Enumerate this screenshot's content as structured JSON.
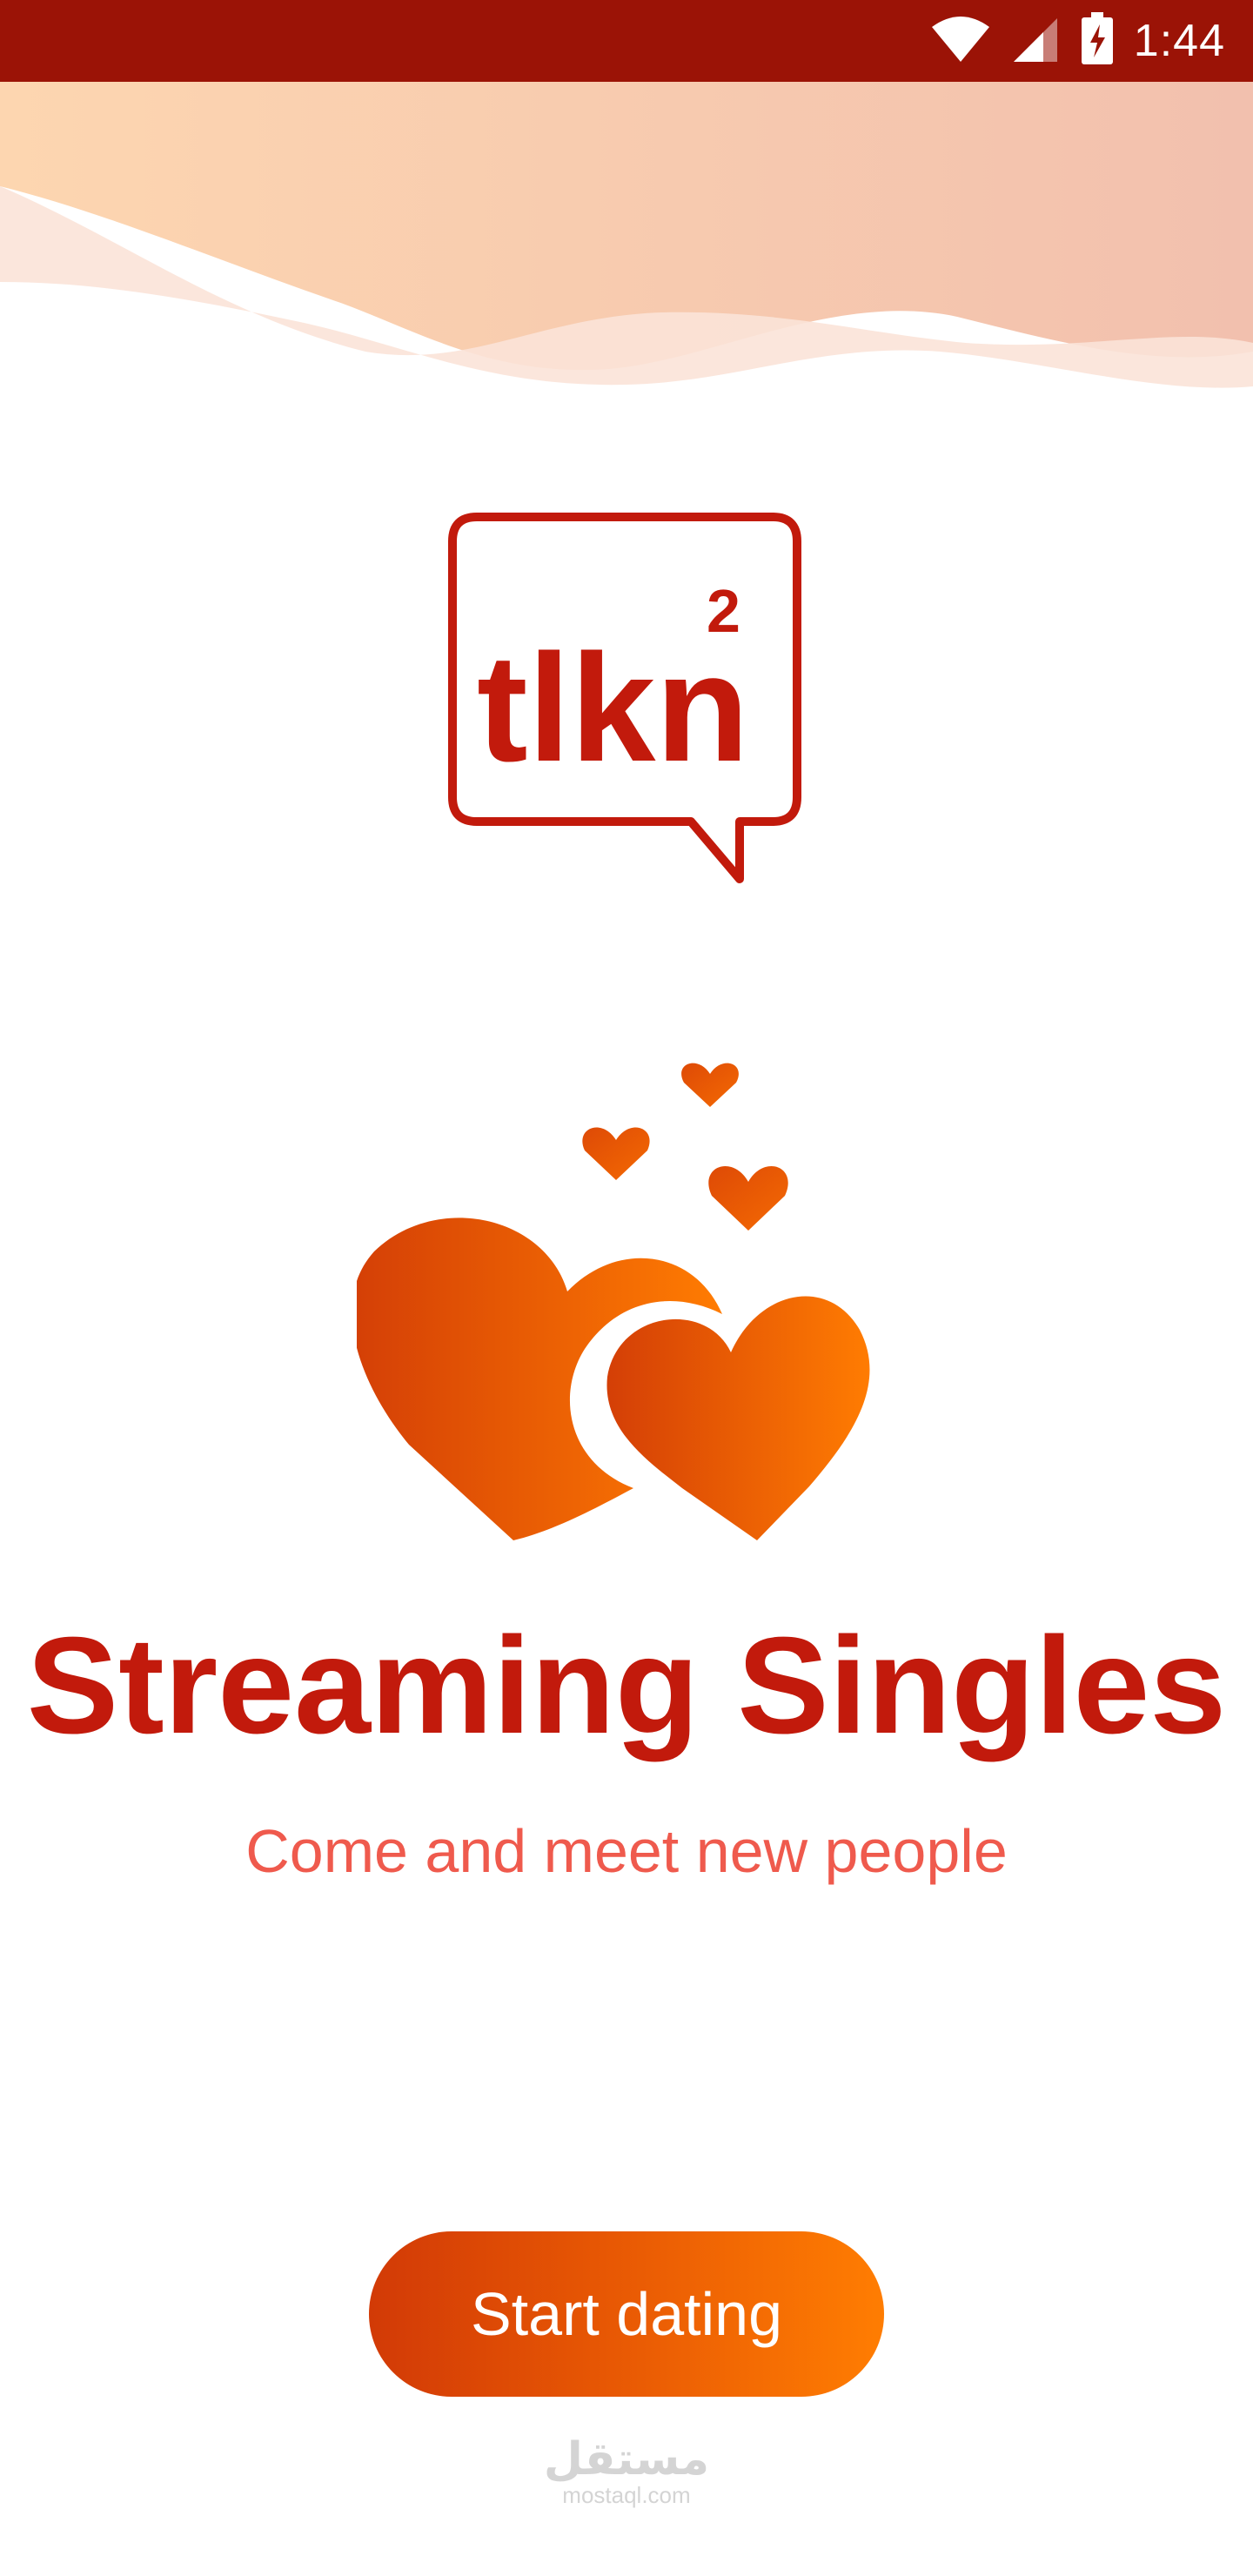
{
  "status_bar": {
    "time": "1:44",
    "icons": [
      "wifi-icon",
      "signal-icon",
      "battery-charging-icon"
    ],
    "background": "#9b1306"
  },
  "logo": {
    "text": "tlkn",
    "superscript": "2",
    "color": "#c21a0c"
  },
  "hero": {
    "title": "Streaming Singles",
    "subtitle": "Come and meet new people",
    "title_color": "#c21a0c",
    "subtitle_color": "#ef5a4d"
  },
  "actions": {
    "start_label": "Start dating",
    "gradient": [
      "#d23a06",
      "#ff7d02"
    ]
  },
  "watermark": {
    "arabic": "مستقل",
    "url": "mostaql.com"
  }
}
